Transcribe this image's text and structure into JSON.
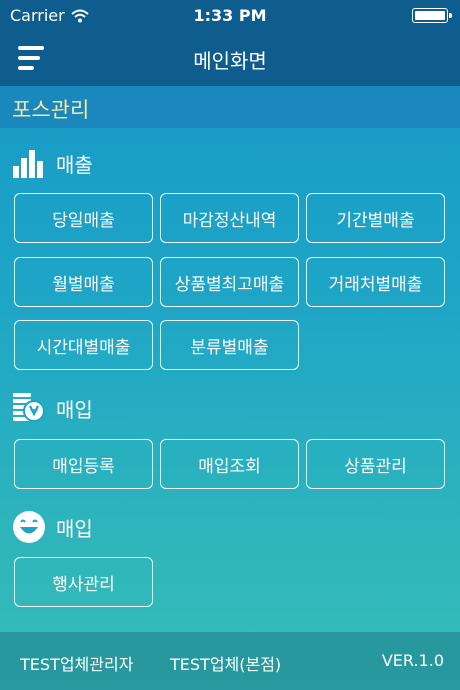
{
  "status_bar": {
    "carrier": "Carrier",
    "time": "1:33 PM"
  },
  "nav": {
    "title": "메인화면"
  },
  "section": {
    "title": "포스관리"
  },
  "sales": {
    "title": "매출",
    "buttons": [
      "당일매출",
      "마감정산내역",
      "기간별매출",
      "월별매출",
      "상품별최고매출",
      "거래처별매출",
      "시간대별매출",
      "분류별매출"
    ]
  },
  "purchase": {
    "title": "매입",
    "buttons": [
      "매입등록",
      "매입조회",
      "상품관리"
    ]
  },
  "event": {
    "title": "매입",
    "buttons": [
      "행사관리"
    ]
  },
  "footer": {
    "user": "TEST업체관리자",
    "store": "TEST업체(본점)",
    "version": "VER.1.0"
  },
  "icons": {
    "wifi": "wifi-icon",
    "battery": "battery-icon",
    "menu": "hamburger-menu-icon",
    "sales": "bar-chart-icon",
    "purchase": "coin-stack-icon",
    "event": "smiley-icon"
  }
}
